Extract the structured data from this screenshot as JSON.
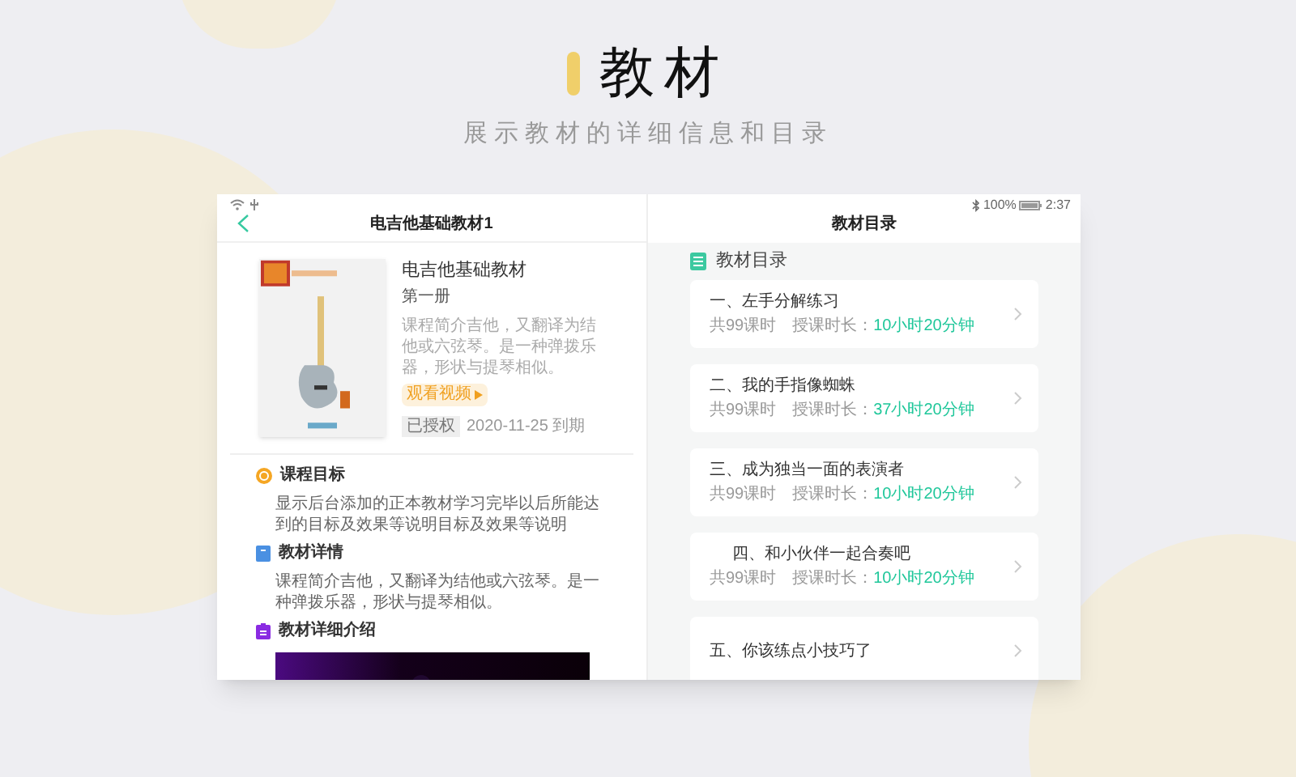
{
  "hero": {
    "title": "教材",
    "subtitle": "展示教材的详细信息和目录"
  },
  "status_bar": {
    "battery": "100%",
    "time": "2:37"
  },
  "left_panel": {
    "title": "电吉他基础教材1",
    "book": {
      "title": "电吉他基础教材",
      "volume": "第一册",
      "description": "课程简介吉他，又翻译为结他或六弦琴。是一种弹拨乐器，形状与提琴相似。",
      "video_button": "观看视频",
      "status": "已授权",
      "expiry": "2020-11-25 到期"
    },
    "sections": [
      {
        "kind": "goal",
        "title": "课程目标",
        "text": "显示后台添加的正本教材学习完毕以后所能达到的目标及效果等说明目标及效果等说明"
      },
      {
        "kind": "detail",
        "title": "教材详情",
        "text": "课程简介吉他，又翻译为结他或六弦琴。是一种弹拨乐器，形状与提琴相似。"
      },
      {
        "kind": "intro",
        "title": "教材详细介绍"
      }
    ]
  },
  "right_panel": {
    "title": "教材目录",
    "heading": "教材目录",
    "chapters": [
      {
        "title": "一、左手分解练习",
        "indented": false,
        "lessons": "共99课时",
        "duration_label": "授课时长：",
        "duration": "10小时20分钟"
      },
      {
        "title": "二、我的手指像蜘蛛",
        "indented": false,
        "lessons": "共99课时",
        "duration_label": "授课时长：",
        "duration": "37小时20分钟"
      },
      {
        "title": "三、成为独当一面的表演者",
        "indented": false,
        "lessons": "共99课时",
        "duration_label": "授课时长：",
        "duration": "10小时20分钟"
      },
      {
        "title": "四、和小伙伴一起合奏吧",
        "indented": true,
        "lessons": "共99课时",
        "duration_label": "授课时长：",
        "duration": "10小时20分钟"
      },
      {
        "title": "五、你该练点小技巧了",
        "indented": false
      }
    ]
  }
}
